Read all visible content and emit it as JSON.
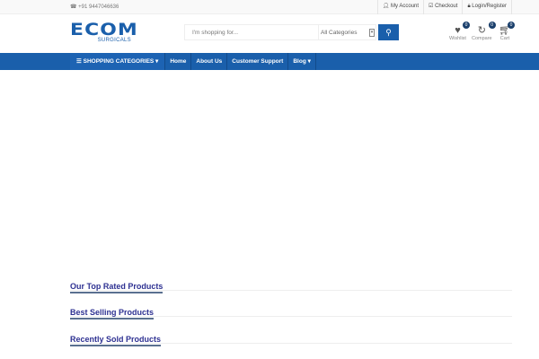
{
  "topbar": {
    "phone": "+91 9447046636",
    "links": [
      "My Account",
      "Checkout",
      "Login/Register"
    ]
  },
  "logo": {
    "brand": "ECOM",
    "sub": "SURGICALS"
  },
  "search": {
    "placeholder": "I'm shopping for...",
    "category": "All Categories"
  },
  "header_icons": [
    {
      "label": "Wishlist",
      "count": "0"
    },
    {
      "label": "Compare",
      "count": "0"
    },
    {
      "label": "Cart",
      "count": "0"
    }
  ],
  "nav": {
    "items": [
      "SHOPPING CATEGORIES ▾",
      "Home",
      "About Us",
      "Customer Support",
      "Blog ▾"
    ]
  },
  "sections": [
    "Our Top Rated Products",
    "Best Selling Products",
    "Recently Sold Products"
  ],
  "colors": {
    "primary": "#1a5fab",
    "heading": "#2e3192"
  }
}
